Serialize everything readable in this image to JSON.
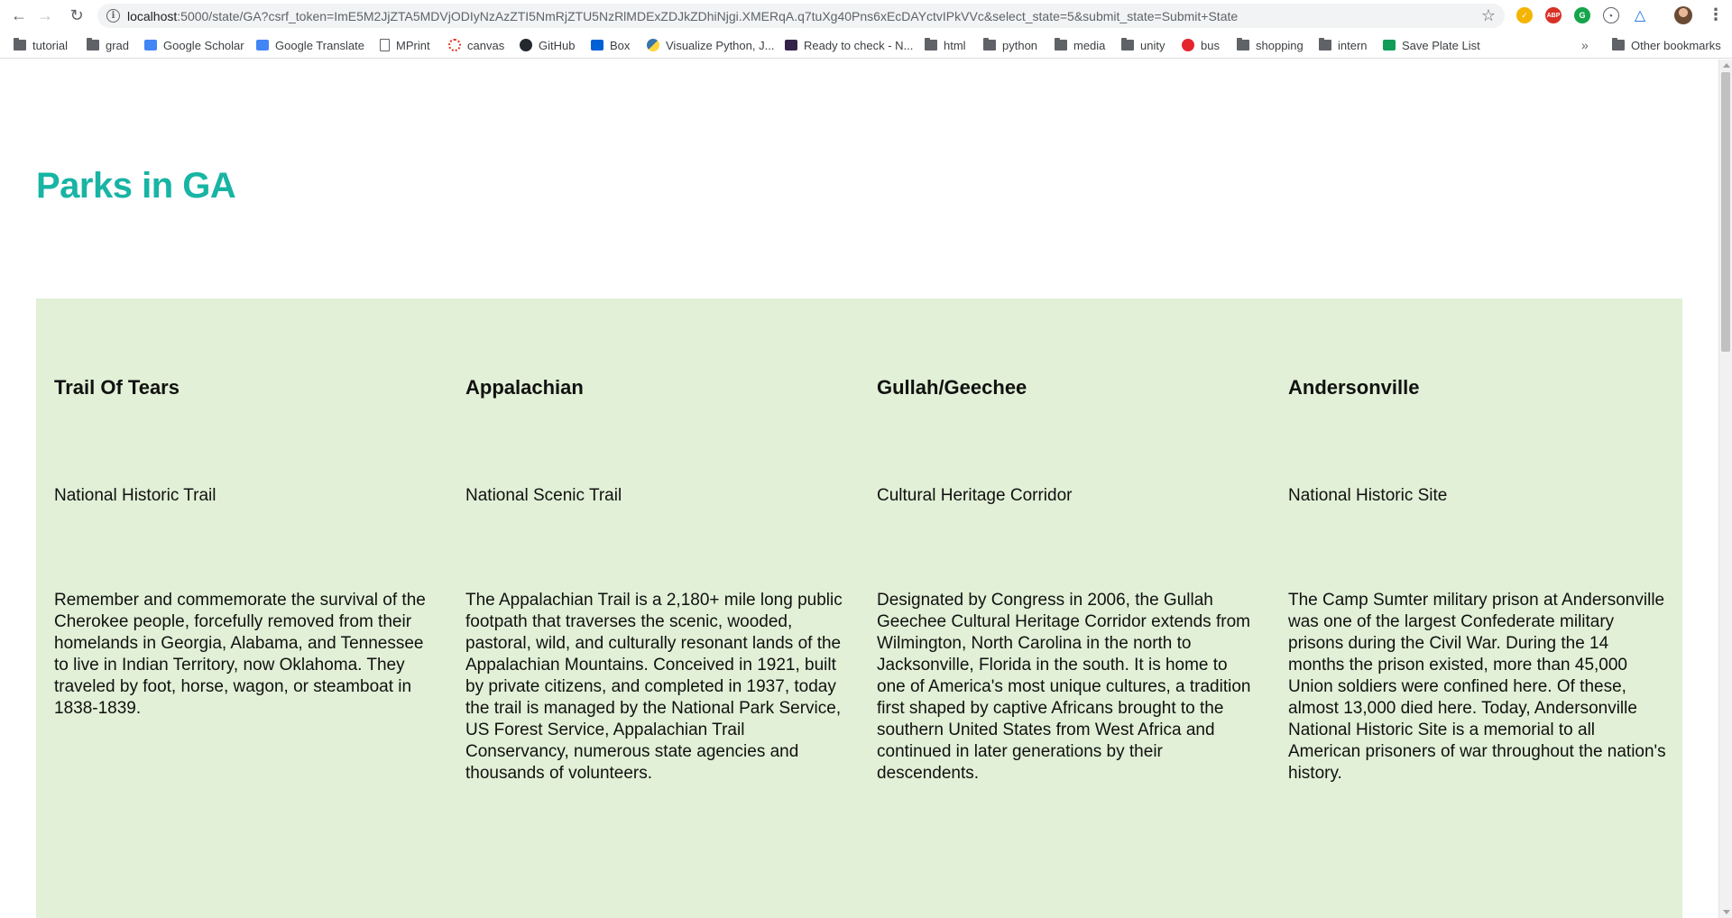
{
  "browser": {
    "url_host": "localhost",
    "url_rest": ":5000/state/GA?csrf_token=ImE5M2JjZTA5MDVjODIyNzAzZTI5NmRjZTU5NzRlMDExZDJkZDhiNjgi.XMERqA.q7tuXg40Pns6xEcDAYctvIPkVVc&select_state=5&submit_state=Submit+State",
    "bookmarks": [
      {
        "label": "tutorial",
        "icon": "folder-icon"
      },
      {
        "label": "grad",
        "icon": "folder-icon"
      },
      {
        "label": "Google Scholar",
        "icon": "google-scholar-icon"
      },
      {
        "label": "Google Translate",
        "icon": "google-translate-icon"
      },
      {
        "label": "MPrint",
        "icon": "page-icon"
      },
      {
        "label": "canvas",
        "icon": "canvas-icon"
      },
      {
        "label": "GitHub",
        "icon": "github-icon"
      },
      {
        "label": "Box",
        "icon": "box-icon"
      },
      {
        "label": "Visualize Python, J...",
        "icon": "python-icon"
      },
      {
        "label": "Ready to check - N...",
        "icon": "ready-to-check-icon"
      },
      {
        "label": "html",
        "icon": "folder-icon"
      },
      {
        "label": "python",
        "icon": "folder-icon"
      },
      {
        "label": "media",
        "icon": "folder-icon"
      },
      {
        "label": "unity",
        "icon": "folder-icon"
      },
      {
        "label": "bus",
        "icon": "bus-icon"
      },
      {
        "label": "shopping",
        "icon": "folder-icon"
      },
      {
        "label": "intern",
        "icon": "folder-icon"
      },
      {
        "label": "Save Plate List",
        "icon": "sheets-icon"
      }
    ],
    "more_bookmarks": "»",
    "other_bookmarks": "Other bookmarks",
    "extension_abp": "ABP"
  },
  "page": {
    "title": "Parks in GA",
    "panel_color": "#e1f0d6",
    "title_color": "#18b4a4",
    "parks": [
      {
        "name": "Trail Of Tears",
        "designation": "National Historic Trail",
        "description": "Remember and commemorate the survival of the Cherokee people, forcefully removed from their homelands in Georgia, Alabama, and Tennessee to live in Indian Territory, now Oklahoma. They traveled by foot, horse, wagon, or steamboat in 1838-1839."
      },
      {
        "name": "Appalachian",
        "designation": "National Scenic Trail",
        "description": "The Appalachian Trail is a 2,180+ mile long public footpath that traverses the scenic, wooded, pastoral, wild, and culturally resonant lands of the Appalachian Mountains. Conceived in 1921, built by private citizens, and completed in 1937, today the trail is managed by the National Park Service, US Forest Service, Appalachian Trail Conservancy, numerous state agencies and thousands of volunteers."
      },
      {
        "name": "Gullah/Geechee",
        "designation": "Cultural Heritage Corridor",
        "description": "Designated by Congress in 2006, the Gullah Geechee Cultural Heritage Corridor extends from Wilmington, North Carolina in the north to Jacksonville, Florida in the south. It is home to one of America's most unique cultures, a tradition first shaped by captive Africans brought to the southern United States from West Africa and continued in later generations by their descendents."
      },
      {
        "name": "Andersonville",
        "designation": "National Historic Site",
        "description": "The Camp Sumter military prison at Andersonville was one of the largest Confederate military prisons during the Civil War. During the 14 months the prison existed, more than 45,000 Union soldiers were confined here. Of these, almost 13,000 died here. Today, Andersonville National Historic Site is a memorial to all American prisoners of war throughout the nation's history."
      }
    ]
  }
}
